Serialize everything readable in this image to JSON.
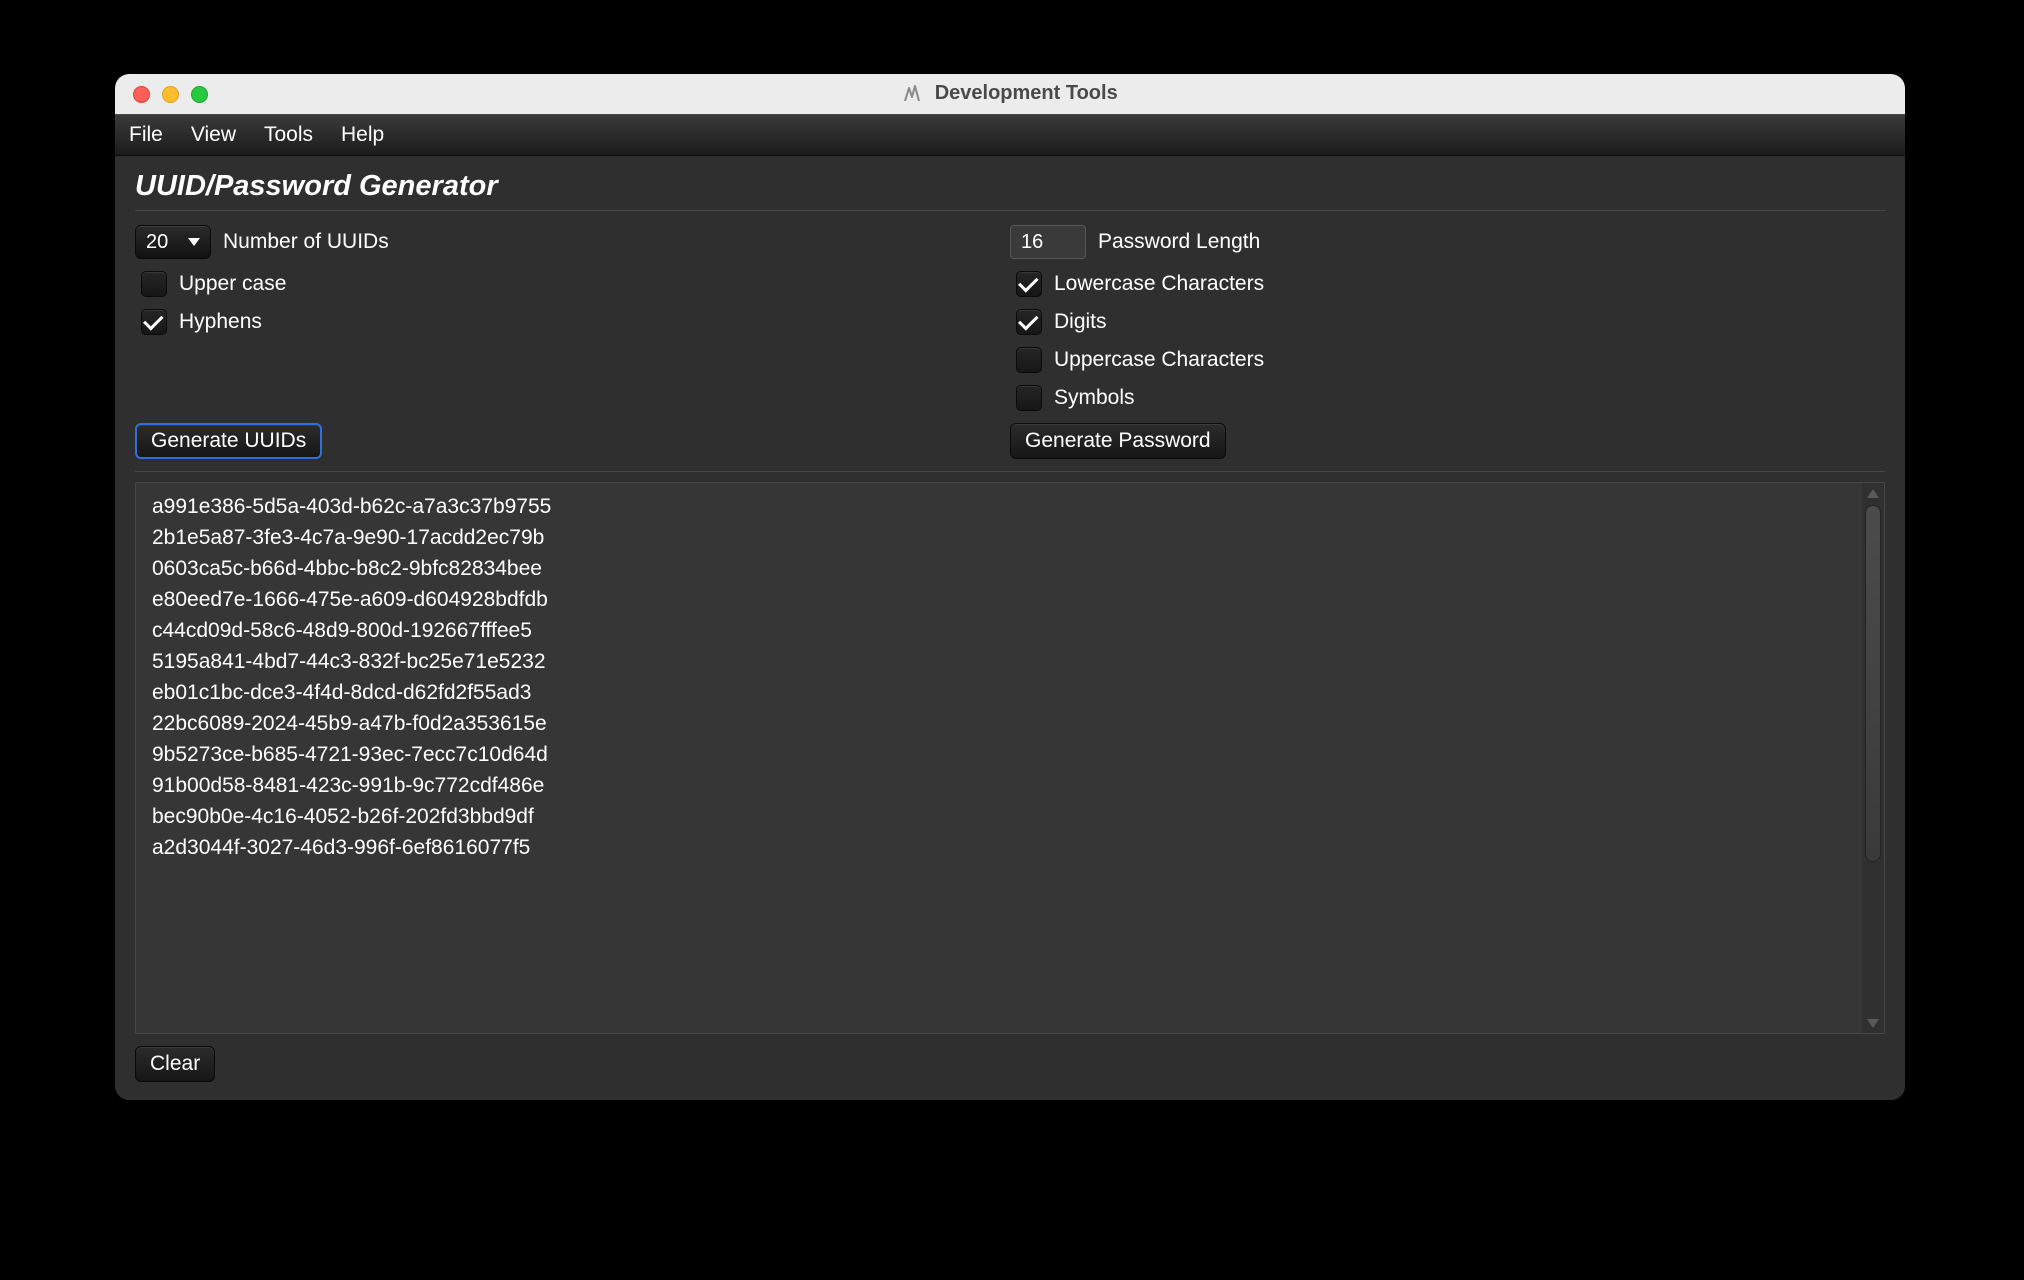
{
  "window": {
    "title": "Development Tools"
  },
  "menu": {
    "file": "File",
    "view": "View",
    "tools": "Tools",
    "help": "Help"
  },
  "page": {
    "title": "UUID/Password Generator"
  },
  "uuid": {
    "count": "20",
    "count_label": "Number of UUIDs",
    "uppercase": {
      "label": "Upper case",
      "checked": false
    },
    "hyphens": {
      "label": "Hyphens",
      "checked": true
    },
    "generate_btn": "Generate UUIDs"
  },
  "password": {
    "length": "16",
    "length_label": "Password Length",
    "lowercase": {
      "label": "Lowercase Characters",
      "checked": true
    },
    "digits": {
      "label": "Digits",
      "checked": true
    },
    "uppercase": {
      "label": "Uppercase Characters",
      "checked": false
    },
    "symbols": {
      "label": "Symbols",
      "checked": false
    },
    "generate_btn": "Generate Password"
  },
  "output": {
    "lines": [
      "a991e386-5d5a-403d-b62c-a7a3c37b9755",
      "2b1e5a87-3fe3-4c7a-9e90-17acdd2ec79b",
      "0603ca5c-b66d-4bbc-b8c2-9bfc82834bee",
      "e80eed7e-1666-475e-a609-d604928bdfdb",
      "c44cd09d-58c6-48d9-800d-192667fffee5",
      "5195a841-4bd7-44c3-832f-bc25e71e5232",
      "eb01c1bc-dce3-4f4d-8dcd-d62fd2f55ad3",
      "22bc6089-2024-45b9-a47b-f0d2a353615e",
      "9b5273ce-b685-4721-93ec-7ecc7c10d64d",
      "91b00d58-8481-423c-991b-9c772cdf486e",
      "bec90b0e-4c16-4052-b26f-202fd3bbd9df",
      "a2d3044f-3027-46d3-996f-6ef8616077f5"
    ]
  },
  "footer": {
    "clear_btn": "Clear"
  }
}
